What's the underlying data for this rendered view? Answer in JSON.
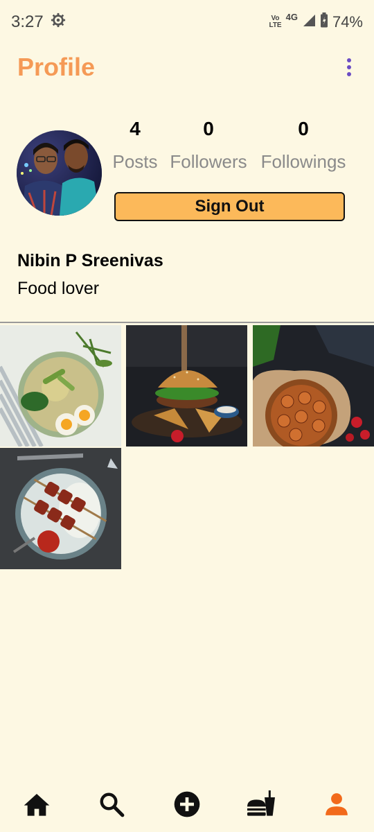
{
  "status_bar": {
    "time": "3:27",
    "network_top": "Vo",
    "network_bottom": "LTE",
    "network_type": "4G",
    "battery": "74%"
  },
  "header": {
    "title": "Profile"
  },
  "profile": {
    "stats": [
      {
        "value": "4",
        "label": "Posts"
      },
      {
        "value": "0",
        "label": "Followers"
      },
      {
        "value": "0",
        "label": "Followings"
      }
    ],
    "sign_out_label": "Sign Out",
    "name": "Nibin P Sreenivas",
    "bio": "Food lover"
  },
  "posts": [
    {
      "icon": "salad-bowl-photo"
    },
    {
      "icon": "burger-photo"
    },
    {
      "icon": "tart-photo"
    },
    {
      "icon": "skewer-plate-photo"
    }
  ],
  "nav": {
    "items": [
      "home-icon",
      "search-icon",
      "add-circle-icon",
      "fastfood-icon",
      "person-icon"
    ],
    "active": "person-icon"
  },
  "colors": {
    "background": "#fdf8e3",
    "accent": "#f59a56",
    "button": "#fcb95a",
    "active_nav": "#f26a1b",
    "menu_dots": "#6b4cc4"
  }
}
